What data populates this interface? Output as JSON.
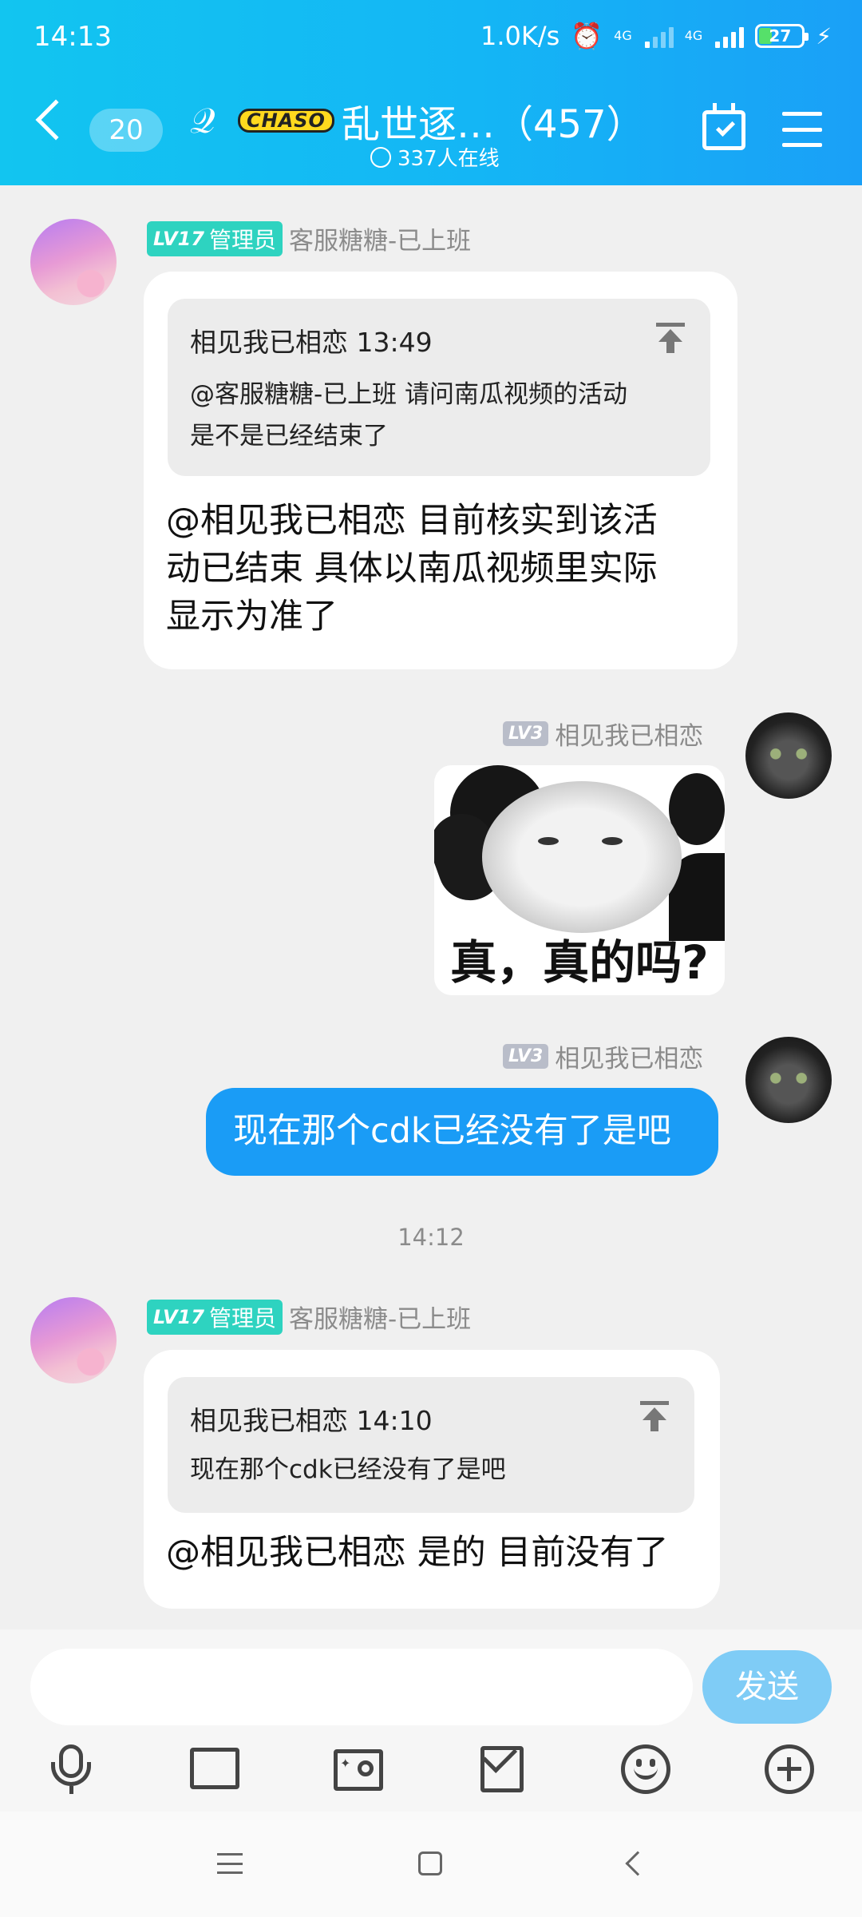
{
  "status_bar": {
    "time": "14:13",
    "net_speed": "1.0K/s",
    "net1": "4G",
    "net2": "4G",
    "battery": "27"
  },
  "header": {
    "unread_count": "20",
    "group_logo_text": "CHASO",
    "group_title": "乱世逐…（457）",
    "online": "337人在线"
  },
  "messages": [
    {
      "level": "LV17",
      "role": "管理员",
      "sender": "客服糖糖-已上班",
      "quote_header": "相见我已相恋 13:49",
      "quote_line1": "@客服糖糖-已上班 请问南瓜视频的活动",
      "quote_line2": "是不是已经结束了",
      "text_line1": "@相见我已相恋 目前核实到该活",
      "text_line2": "动已结束  具体以南瓜视频里实际",
      "text_line3": "显示为准了"
    },
    {
      "level": "LV3",
      "sender": "相见我已相恋",
      "sticker_caption": "真，真的吗?"
    },
    {
      "level": "LV3",
      "sender": "相见我已相恋",
      "text": "现在那个cdk已经没有了是吧"
    },
    {
      "level": "LV17",
      "role": "管理员",
      "sender": "客服糖糖-已上班",
      "quote_header": "相见我已相恋 14:10",
      "quote_line1": "现在那个cdk已经没有了是吧",
      "text": "@相见我已相恋 是的 目前没有了"
    }
  ],
  "timestamp": "14:12",
  "input": {
    "send_label": "发送",
    "placeholder": ""
  },
  "colors": {
    "header_start": "#12c5f0",
    "header_end": "#1aa0f7",
    "my_bubble": "#1a9cf6",
    "admin_tag": "#2ed3c0",
    "send_button": "#7fccf6"
  }
}
